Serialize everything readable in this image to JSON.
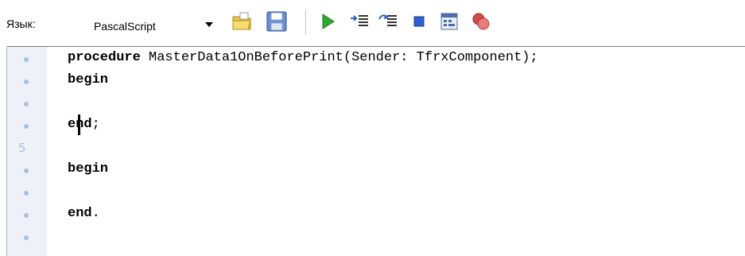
{
  "toolbar": {
    "language_label": "Язык:",
    "language_value": "PascalScript",
    "icons": [
      "open-folder-icon",
      "save-icon",
      "run-icon",
      "step-into-icon",
      "step-over-icon",
      "stop-icon",
      "evaluate-icon",
      "breakpoint-icon"
    ]
  },
  "editor": {
    "gutter": [
      "•",
      "•",
      "•",
      "•",
      "5",
      "•",
      "•",
      "•",
      "•"
    ],
    "lines": [
      {
        "kw": "procedure",
        "rest": " MasterData1OnBeforePrint(Sender: TfrxComponent);"
      },
      {
        "kw": "begin",
        "rest": ""
      },
      {
        "kw": "",
        "rest": ""
      },
      {
        "kw": "end",
        "rest": ";"
      },
      {
        "kw": "",
        "rest": ""
      },
      {
        "kw": "begin",
        "rest": ""
      },
      {
        "kw": "",
        "rest": ""
      },
      {
        "kw": "end",
        "rest": "."
      },
      {
        "kw": "",
        "rest": ""
      }
    ]
  },
  "colors": {
    "gutter_bg": "#eef2f8",
    "gutter_mark": "#a8c1dd",
    "accent_green": "#2eaa2e",
    "stop_blue": "#2f5fd0"
  }
}
